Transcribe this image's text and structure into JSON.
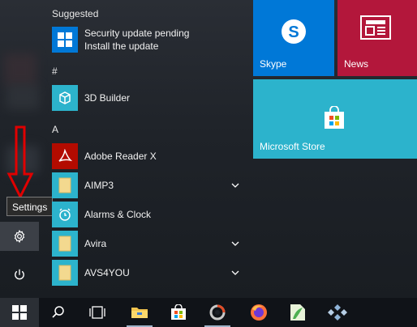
{
  "sections": {
    "suggested": "Suggested",
    "hash": "#",
    "a": "A"
  },
  "suggested_item": {
    "line1": "Security update pending",
    "line2": "Install the update"
  },
  "apps": [
    {
      "label": "3D Builder"
    },
    {
      "label": "Adobe Reader X"
    },
    {
      "label": "AIMP3"
    },
    {
      "label": "Alarms & Clock"
    },
    {
      "label": "Avira"
    },
    {
      "label": "AVS4YOU"
    }
  ],
  "tooltip": "Settings",
  "tiles": {
    "skype": "Skype",
    "news": "News",
    "store": "Microsoft Store"
  },
  "colors": {
    "accent_blue": "#0078d7",
    "tile_cyan": "#2cb3cc",
    "news_red": "#b3173b",
    "folder_yellow": "#f3d98f",
    "arrow_red": "#e00000"
  },
  "icons": {
    "taskbar": [
      "windows-logo-icon",
      "search-icon",
      "task-view-icon",
      "file-explorer-icon",
      "microsoft-store-icon",
      "app-icon",
      "firefox-icon",
      "app-green-icon",
      "app-controller-icon"
    ]
  }
}
